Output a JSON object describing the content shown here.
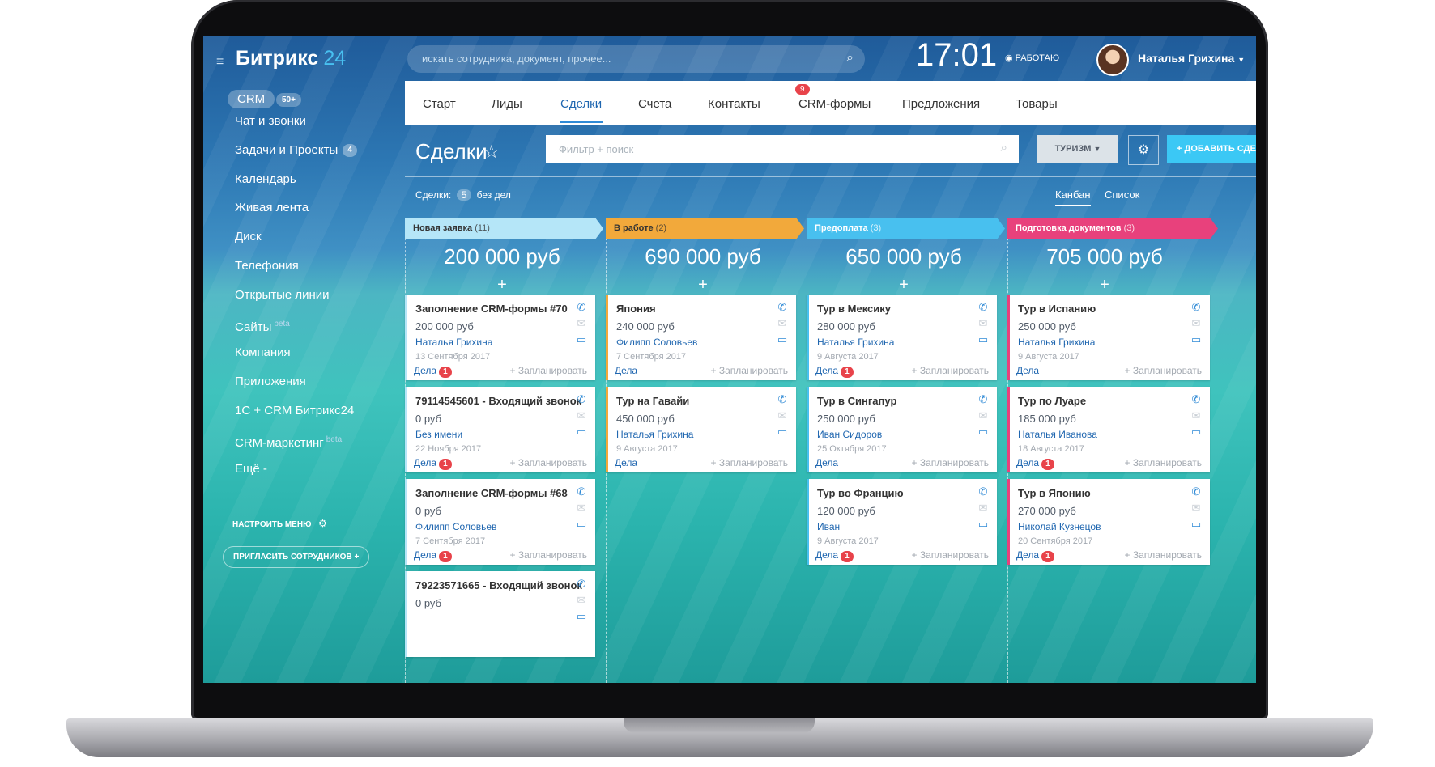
{
  "sidebar": {
    "logo_name": "Битрикс",
    "logo_num": "24",
    "crm_label": "CRM",
    "crm_count": "50+",
    "items": [
      {
        "label": "Чат и звонки"
      },
      {
        "label": "Задачи и Проекты",
        "badge": "4"
      },
      {
        "label": "Календарь"
      },
      {
        "label": "Живая лента"
      },
      {
        "label": "Диск"
      },
      {
        "label": "Телефония"
      },
      {
        "label": "Открытые линии"
      },
      {
        "label": "Сайты",
        "sup": "beta"
      },
      {
        "label": "Компания"
      },
      {
        "label": "Приложения"
      },
      {
        "label": "1С + CRM Битрикс24"
      },
      {
        "label": "CRM-маркетинг",
        "sup": "beta"
      },
      {
        "label": "Ещё -"
      }
    ],
    "setup_menu": "НАСТРОИТЬ МЕНЮ",
    "invite": "ПРИГЛАСИТЬ СОТРУДНИКОВ +"
  },
  "header": {
    "search_placeholder": "искать сотрудника, документ, прочее...",
    "clock": "17:01",
    "status": "РАБОТАЮ",
    "user_name": "Наталья Грихина"
  },
  "tabs": [
    {
      "label": "Старт"
    },
    {
      "label": "Лиды"
    },
    {
      "label": "Сделки",
      "badge": "9"
    },
    {
      "label": "Счета"
    },
    {
      "label": "Контакты"
    },
    {
      "label": "CRM-формы"
    },
    {
      "label": "Предложения"
    },
    {
      "label": "Товары"
    }
  ],
  "toolbar": {
    "title": "Сделки",
    "filter_placeholder": "Фильтр + поиск",
    "category": "ТУРИЗМ",
    "add_label": "+ ДОБАВИТЬ СДЕЛКУ",
    "deals_label": "Сделки:",
    "deals_count": "5",
    "deals_suffix": "без дел",
    "view_kanban": "Канбан",
    "view_list": "Список"
  },
  "kanban": {
    "columns": [
      {
        "name": "Новая заявка",
        "count": "(11)",
        "color": "#b5e6f8",
        "text_color": "#333333",
        "sum": "200 000 руб",
        "cards": [
          {
            "title": "Заполнение CRM-формы #70",
            "price": "200 000 руб",
            "person": "Наталья Грихина",
            "date": "13 Сентября 2017",
            "tasks": "Дела",
            "tasks_badge": "1",
            "plan": "+ Запланировать"
          },
          {
            "title": "79114545601 - Входящий звонок",
            "price": "0 руб",
            "person": "Без имени",
            "date": "22 Ноября 2017",
            "tasks": "Дела",
            "tasks_badge": "1",
            "plan": "+ Запланировать"
          },
          {
            "title": "Заполнение CRM-формы #68",
            "price": "0 руб",
            "person": "Филипп Соловьев",
            "date": "7 Сентября 2017",
            "tasks": "Дела",
            "tasks_badge": "1",
            "plan": "+ Запланировать"
          },
          {
            "title": "79223571665 - Входящий звонок",
            "price": "0 руб",
            "person": "",
            "date": "",
            "tasks": "",
            "tasks_badge": "",
            "plan": ""
          }
        ]
      },
      {
        "name": "В работе",
        "count": "(2)",
        "color": "#f2a93b",
        "text_color": "#333333",
        "sum": "690 000 руб",
        "cards": [
          {
            "title": "Япония",
            "price": "240 000 руб",
            "person": "Филипп Соловьев",
            "date": "7 Сентября 2017",
            "tasks": "Дела",
            "tasks_badge": "",
            "plan": "+ Запланировать"
          },
          {
            "title": "Тур на Гавайи",
            "price": "450 000 руб",
            "person": "Наталья Грихина",
            "date": "9 Августа 2017",
            "tasks": "Дела",
            "tasks_badge": "",
            "plan": "+ Запланировать"
          }
        ]
      },
      {
        "name": "Предоплата",
        "count": "(3)",
        "color": "#48c0ef",
        "text_color": "#ffffff",
        "sum": "650 000 руб",
        "cards": [
          {
            "title": "Тур в Мексику",
            "price": "280 000 руб",
            "person": "Наталья Грихина",
            "date": "9 Августа 2017",
            "tasks": "Дела",
            "tasks_badge": "1",
            "plan": "+ Запланировать"
          },
          {
            "title": "Тур в Сингапур",
            "price": "250 000 руб",
            "person": "Иван Сидоров",
            "date": "25 Октября 2017",
            "tasks": "Дела",
            "tasks_badge": "",
            "plan": "+ Запланировать"
          },
          {
            "title": "Тур во Францию",
            "price": "120 000 руб",
            "person": "Иван",
            "date": "9 Августа 2017",
            "tasks": "Дела",
            "tasks_badge": "1",
            "plan": "+ Запланировать"
          }
        ]
      },
      {
        "name": "Подготовка документов",
        "count": "(3)",
        "color": "#e8417c",
        "text_color": "#ffffff",
        "sum": "705 000 руб",
        "cards": [
          {
            "title": "Тур в Испанию",
            "price": "250 000 руб",
            "person": "Наталья Грихина",
            "date": "9 Августа 2017",
            "tasks": "Дела",
            "tasks_badge": "",
            "plan": "+ Запланировать"
          },
          {
            "title": "Тур по Луаре",
            "price": "185 000 руб",
            "person": "Наталья Иванова",
            "date": "18 Августа 2017",
            "tasks": "Дела",
            "tasks_badge": "1",
            "plan": "+ Запланировать"
          },
          {
            "title": "Тур в Японию",
            "price": "270 000 руб",
            "person": "Николай Кузнецов",
            "date": "20 Сентября 2017",
            "tasks": "Дела",
            "tasks_badge": "1",
            "plan": "+ Запланировать"
          }
        ]
      }
    ]
  }
}
